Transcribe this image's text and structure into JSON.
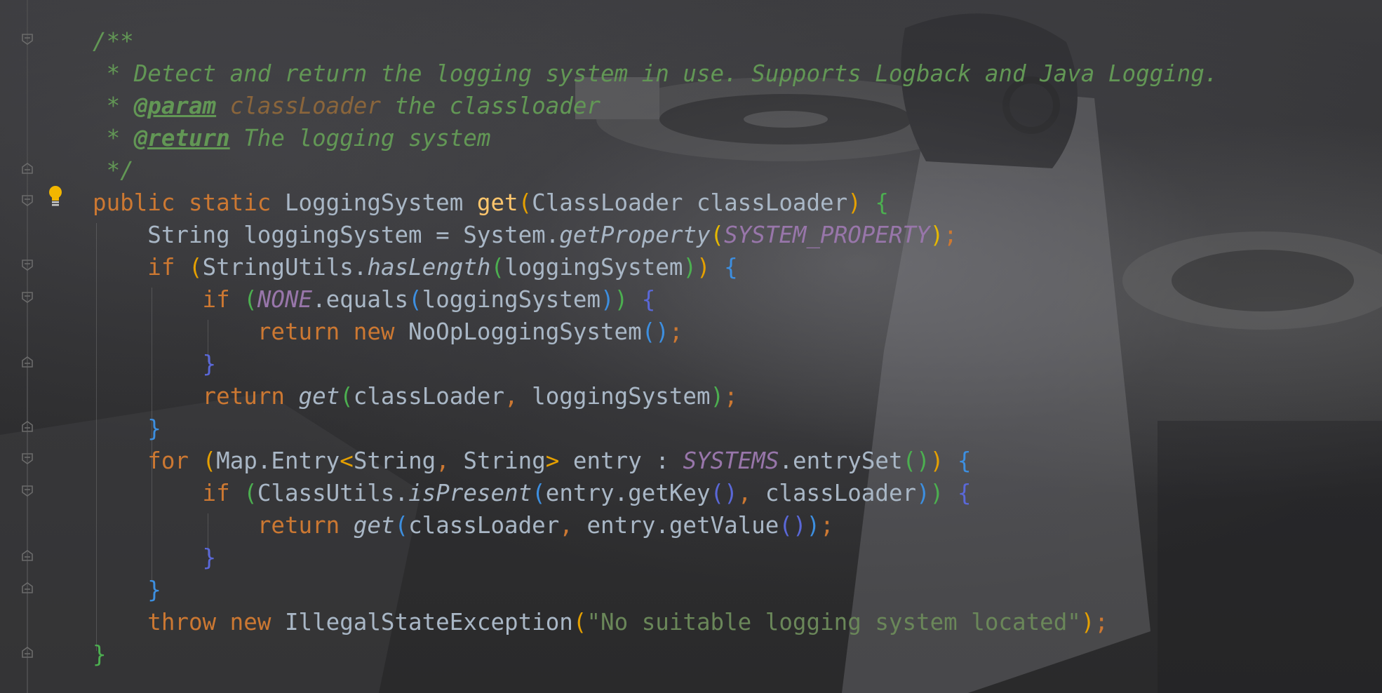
{
  "editor": {
    "language": "Java",
    "theme_colors": {
      "keyword": "#cc7832",
      "method_declaration": "#ffc66d",
      "string": "#6a8759",
      "constant": "#9876aa",
      "doc_comment": "#629755",
      "plain": "#a9b7c6"
    },
    "intention_icon": "lightbulb-icon",
    "lines": [
      [
        {
          "t": "/**",
          "c": "doc"
        }
      ],
      [
        {
          "t": " * Detect and return the logging system in use. Supports Logback and Java Logging.",
          "c": "doc"
        }
      ],
      [
        {
          "t": " * ",
          "c": "doc"
        },
        {
          "t": "@param",
          "c": "tag"
        },
        {
          "t": " ",
          "c": "doc"
        },
        {
          "t": "classLoader",
          "c": "pname"
        },
        {
          "t": " the classloader",
          "c": "doc"
        }
      ],
      [
        {
          "t": " * ",
          "c": "doc"
        },
        {
          "t": "@return",
          "c": "tag"
        },
        {
          "t": " The logging system",
          "c": "doc"
        }
      ],
      [
        {
          "t": " */",
          "c": "doc"
        }
      ],
      [
        {
          "t": "public static ",
          "c": "kw"
        },
        {
          "t": "LoggingSystem ",
          "c": ""
        },
        {
          "t": "get",
          "c": "fn"
        },
        {
          "t": "(",
          "c": "b-o"
        },
        {
          "t": "ClassLoader classLoader",
          "c": ""
        },
        {
          "t": ")",
          "c": "b-o"
        },
        {
          "t": " ",
          "c": ""
        },
        {
          "t": "{",
          "c": "b-g"
        }
      ],
      [
        {
          "t": "    String loggingSystem = System.",
          "c": ""
        },
        {
          "t": "getProperty",
          "c": "it"
        },
        {
          "t": "(",
          "c": "b-y"
        },
        {
          "t": "SYSTEM_PROPERTY",
          "c": "const"
        },
        {
          "t": ")",
          "c": "b-y"
        },
        {
          "t": ";",
          "c": "kw"
        }
      ],
      [
        {
          "t": "    ",
          "c": ""
        },
        {
          "t": "if ",
          "c": "kw"
        },
        {
          "t": "(",
          "c": "b-o"
        },
        {
          "t": "StringUtils.",
          "c": ""
        },
        {
          "t": "hasLength",
          "c": "it"
        },
        {
          "t": "(",
          "c": "b-g"
        },
        {
          "t": "loggingSystem",
          "c": ""
        },
        {
          "t": ")",
          "c": "b-g"
        },
        {
          "t": ")",
          "c": "b-o"
        },
        {
          "t": " ",
          "c": ""
        },
        {
          "t": "{",
          "c": "b-b"
        }
      ],
      [
        {
          "t": "        ",
          "c": ""
        },
        {
          "t": "if ",
          "c": "kw"
        },
        {
          "t": "(",
          "c": "b-g"
        },
        {
          "t": "NONE",
          "c": "const"
        },
        {
          "t": ".equals",
          "c": ""
        },
        {
          "t": "(",
          "c": "b-b"
        },
        {
          "t": "loggingSystem",
          "c": ""
        },
        {
          "t": ")",
          "c": "b-b"
        },
        {
          "t": ")",
          "c": "b-g"
        },
        {
          "t": " ",
          "c": ""
        },
        {
          "t": "{",
          "c": "b-p"
        }
      ],
      [
        {
          "t": "            ",
          "c": ""
        },
        {
          "t": "return new ",
          "c": "kw"
        },
        {
          "t": "NoOpLoggingSystem",
          "c": ""
        },
        {
          "t": "()",
          "c": "b-b"
        },
        {
          "t": ";",
          "c": "kw"
        }
      ],
      [
        {
          "t": "        ",
          "c": ""
        },
        {
          "t": "}",
          "c": "b-p"
        }
      ],
      [
        {
          "t": "        ",
          "c": ""
        },
        {
          "t": "return ",
          "c": "kw"
        },
        {
          "t": "get",
          "c": "it"
        },
        {
          "t": "(",
          "c": "b-g"
        },
        {
          "t": "classLoader",
          "c": ""
        },
        {
          "t": ", ",
          "c": "kw"
        },
        {
          "t": "loggingSystem",
          "c": ""
        },
        {
          "t": ")",
          "c": "b-g"
        },
        {
          "t": ";",
          "c": "kw"
        }
      ],
      [
        {
          "t": "    ",
          "c": ""
        },
        {
          "t": "}",
          "c": "b-b"
        }
      ],
      [
        {
          "t": "    ",
          "c": ""
        },
        {
          "t": "for ",
          "c": "kw"
        },
        {
          "t": "(",
          "c": "b-o"
        },
        {
          "t": "Map.Entry",
          "c": ""
        },
        {
          "t": "<",
          "c": "b-o"
        },
        {
          "t": "String",
          "c": ""
        },
        {
          "t": ", ",
          "c": "kw"
        },
        {
          "t": "String",
          "c": ""
        },
        {
          "t": ">",
          "c": "b-o"
        },
        {
          "t": " entry : ",
          "c": ""
        },
        {
          "t": "SYSTEMS",
          "c": "const"
        },
        {
          "t": ".entrySet",
          "c": ""
        },
        {
          "t": "()",
          "c": "b-g"
        },
        {
          "t": ")",
          "c": "b-o"
        },
        {
          "t": " ",
          "c": ""
        },
        {
          "t": "{",
          "c": "b-b"
        }
      ],
      [
        {
          "t": "        ",
          "c": ""
        },
        {
          "t": "if ",
          "c": "kw"
        },
        {
          "t": "(",
          "c": "b-g"
        },
        {
          "t": "ClassUtils.",
          "c": ""
        },
        {
          "t": "isPresent",
          "c": "it"
        },
        {
          "t": "(",
          "c": "b-b"
        },
        {
          "t": "entry.getKey",
          "c": ""
        },
        {
          "t": "()",
          "c": "b-p"
        },
        {
          "t": ", ",
          "c": "kw"
        },
        {
          "t": "classLoader",
          "c": ""
        },
        {
          "t": ")",
          "c": "b-b"
        },
        {
          "t": ")",
          "c": "b-g"
        },
        {
          "t": " ",
          "c": ""
        },
        {
          "t": "{",
          "c": "b-p"
        }
      ],
      [
        {
          "t": "            ",
          "c": ""
        },
        {
          "t": "return ",
          "c": "kw"
        },
        {
          "t": "get",
          "c": "it"
        },
        {
          "t": "(",
          "c": "b-b"
        },
        {
          "t": "classLoader",
          "c": ""
        },
        {
          "t": ", ",
          "c": "kw"
        },
        {
          "t": "entry.getValue",
          "c": ""
        },
        {
          "t": "()",
          "c": "b-p"
        },
        {
          "t": ")",
          "c": "b-b"
        },
        {
          "t": ";",
          "c": "kw"
        }
      ],
      [
        {
          "t": "        ",
          "c": ""
        },
        {
          "t": "}",
          "c": "b-p"
        }
      ],
      [
        {
          "t": "    ",
          "c": ""
        },
        {
          "t": "}",
          "c": "b-b"
        }
      ],
      [
        {
          "t": "    ",
          "c": ""
        },
        {
          "t": "throw new ",
          "c": "kw"
        },
        {
          "t": "IllegalStateException",
          "c": ""
        },
        {
          "t": "(",
          "c": "b-o"
        },
        {
          "t": "\"No suitable logging system located\"",
          "c": "str"
        },
        {
          "t": ")",
          "c": "b-o"
        },
        {
          "t": ";",
          "c": "kw"
        }
      ],
      [
        {
          "t": "}",
          "c": "b-g"
        }
      ]
    ]
  }
}
